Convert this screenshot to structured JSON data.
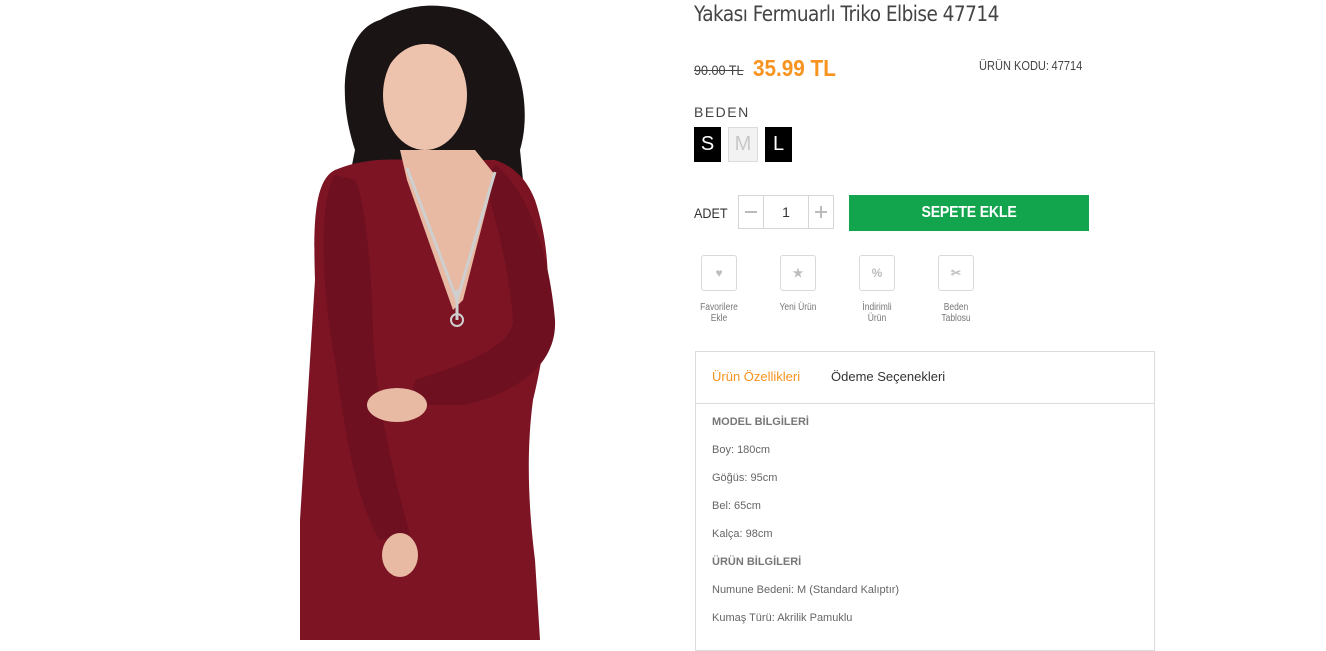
{
  "product": {
    "title": "Yakası Fermuarlı Triko Elbise 47714",
    "old_price": "90.00 TL",
    "new_price": "35.99 TL",
    "sku_label": "ÜRÜN KODU:",
    "sku_value": "47714"
  },
  "sizes": {
    "label": "BEDEN",
    "options": [
      {
        "label": "S",
        "available": true
      },
      {
        "label": "M",
        "available": false
      },
      {
        "label": "L",
        "available": true
      }
    ]
  },
  "quantity": {
    "label": "ADET",
    "value": "1",
    "minus_icon": "minus-icon",
    "plus_icon": "plus-icon"
  },
  "cart": {
    "add_label": "SEPETE EKLE",
    "color": "#13a54e"
  },
  "actions": [
    {
      "label": "Favorilere Ekle",
      "icon": "heart-icon",
      "glyph": "♥"
    },
    {
      "label": "Yeni Ürün",
      "icon": "star-icon",
      "glyph": "★"
    },
    {
      "label": "İndirimli Ürün",
      "icon": "percent-icon",
      "glyph": "%"
    },
    {
      "label": "Beden Tablosu",
      "icon": "scissors-icon",
      "glyph": "✂"
    }
  ],
  "tabs": [
    {
      "label": "Ürün Özellikleri",
      "active": true
    },
    {
      "label": "Ödeme Seçenekleri",
      "active": false
    }
  ],
  "specs": [
    {
      "text": "MODEL BİLGİLERİ",
      "heading": true
    },
    {
      "text": "Boy: 180cm",
      "heading": false
    },
    {
      "text": "Göğüs: 95cm",
      "heading": false
    },
    {
      "text": "Bel: 65cm",
      "heading": false
    },
    {
      "text": "Kalça: 98cm",
      "heading": false
    },
    {
      "text": "ÜRÜN BİLGİLERİ",
      "heading": true
    },
    {
      "text": "Numune Bedeni: M (Standard Kalıptır)",
      "heading": false
    },
    {
      "text": "Kumaş Türü: Akrilik Pamuklu",
      "heading": false
    }
  ],
  "colors": {
    "accent": "#f7931e",
    "dress": "#7c1424"
  }
}
